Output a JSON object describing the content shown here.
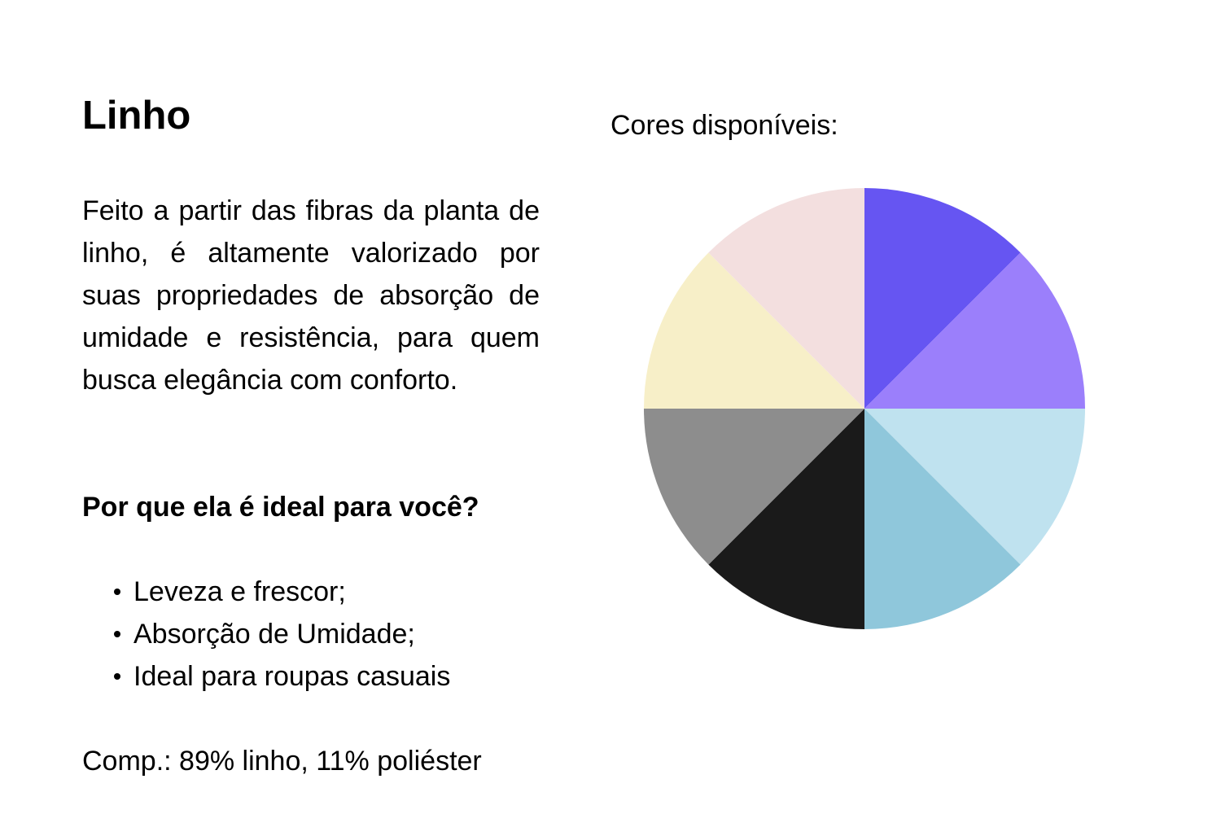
{
  "title": "Linho",
  "description": "Feito a partir das fibras da planta de linho, é altamente valorizado por suas propriedades de absorção de umidade e resistência, para quem busca elegância com conforto.",
  "subheading": "Por que ela é ideal para você?",
  "benefits": [
    "Leveza e frescor;",
    "Absorção de Umidade;",
    "Ideal para roupas casuais"
  ],
  "composition": "Comp.: 89% linho, 11% poliéster",
  "colors_label": "Cores disponíveis:",
  "colors": [
    "#6655f2",
    "#9b7ffb",
    "#bfe2ef",
    "#8fc7db",
    "#1a1a1a",
    "#8d8d8d",
    "#f7efc8",
    "#f3dfdf"
  ]
}
